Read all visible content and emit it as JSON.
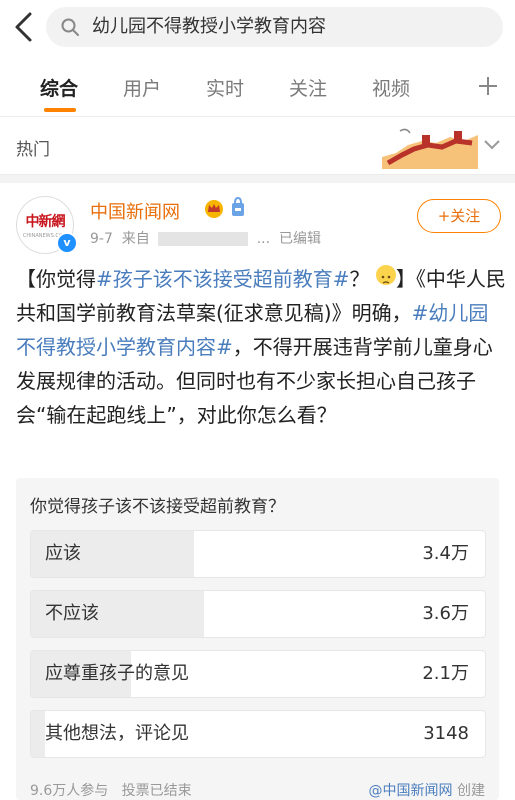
{
  "search": {
    "query": "幼儿园不得教授小学教育内容"
  },
  "tabs": [
    {
      "label": "综合",
      "active": true
    },
    {
      "label": "用户",
      "active": false
    },
    {
      "label": "实时",
      "active": false
    },
    {
      "label": "关注",
      "active": false
    },
    {
      "label": "视频",
      "active": false
    }
  ],
  "hot": {
    "label": "热门"
  },
  "post": {
    "author": "中国新闻网",
    "avatar_text": "中新網",
    "avatar_sub": "CHINANEWS.COM",
    "date": "9-7",
    "source_prefix": "来自",
    "ellipsis": "...",
    "edited": "已编辑",
    "follow_label": "+关注",
    "content": {
      "p1": "【你觉得",
      "tag1": "#孩子该不该接受超前教育#",
      "p2": "？",
      "p3": "】《中华人民共和国学前教育法草案(征求意见稿)》明确，",
      "tag2": "#幼儿园不得教授小学教育内容#",
      "p4": "，不得开展违背学前儿童身心发展规律的活动。但同时也有不少家长担心自己孩子会“输在起跑线上”，对此你怎么看？"
    }
  },
  "poll": {
    "title": "你觉得孩子该不该接受超前教育？",
    "options": [
      {
        "label": "应该",
        "count": "3.4万",
        "share": 0.36
      },
      {
        "label": "不应该",
        "count": "3.6万",
        "share": 0.38
      },
      {
        "label": "应尊重孩子的意见",
        "count": "2.1万",
        "share": 0.22
      },
      {
        "label": "其他想法，评论见",
        "count": "3148",
        "share": 0.03
      }
    ],
    "participants": "9.6万人参与",
    "status": "投票已结束",
    "creator": "@中国新闻网",
    "creator_suffix": "创建"
  },
  "colors": {
    "accent": "#ff8200",
    "author": "#e86f0c",
    "topic": "#4a7dbd"
  }
}
